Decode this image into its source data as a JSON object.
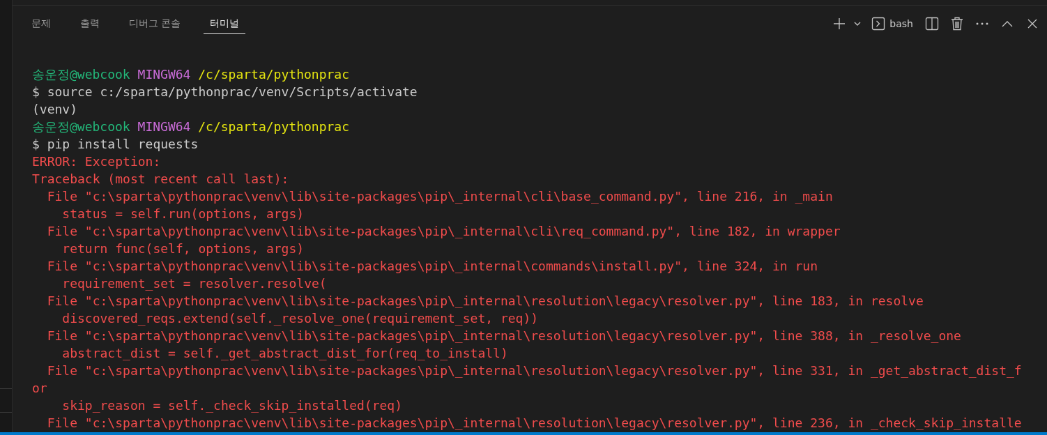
{
  "tabs": [
    {
      "label": "문제",
      "selected": false
    },
    {
      "label": "출력",
      "selected": false
    },
    {
      "label": "디버그 콘솔",
      "selected": false
    },
    {
      "label": "터미널",
      "selected": true
    }
  ],
  "toolbar": {
    "shell": "bash"
  },
  "terminal": {
    "lines": [
      {
        "kind": "prompt",
        "user": "송운정@webcook",
        "system": "MINGW64",
        "path": "/c/sparta/pythonprac"
      },
      {
        "kind": "command",
        "text": "$ source c:/sparta/pythonprac/venv/Scripts/activate"
      },
      {
        "kind": "command",
        "text": "(venv)"
      },
      {
        "kind": "prompt",
        "user": "송운정@webcook",
        "system": "MINGW64",
        "path": "/c/sparta/pythonprac"
      },
      {
        "kind": "command",
        "text": "$ pip install requests"
      },
      {
        "kind": "error",
        "text": "ERROR: Exception:"
      },
      {
        "kind": "error",
        "text": "Traceback (most recent call last):"
      },
      {
        "kind": "error",
        "text": "  File \"c:\\sparta\\pythonprac\\venv\\lib\\site-packages\\pip\\_internal\\cli\\base_command.py\", line 216, in _main"
      },
      {
        "kind": "error",
        "text": "    status = self.run(options, args)"
      },
      {
        "kind": "error",
        "text": "  File \"c:\\sparta\\pythonprac\\venv\\lib\\site-packages\\pip\\_internal\\cli\\req_command.py\", line 182, in wrapper"
      },
      {
        "kind": "error",
        "text": "    return func(self, options, args)"
      },
      {
        "kind": "error",
        "text": "  File \"c:\\sparta\\pythonprac\\venv\\lib\\site-packages\\pip\\_internal\\commands\\install.py\", line 324, in run"
      },
      {
        "kind": "error",
        "text": "    requirement_set = resolver.resolve("
      },
      {
        "kind": "error",
        "text": "  File \"c:\\sparta\\pythonprac\\venv\\lib\\site-packages\\pip\\_internal\\resolution\\legacy\\resolver.py\", line 183, in resolve"
      },
      {
        "kind": "error",
        "text": "    discovered_reqs.extend(self._resolve_one(requirement_set, req))"
      },
      {
        "kind": "error",
        "text": "  File \"c:\\sparta\\pythonprac\\venv\\lib\\site-packages\\pip\\_internal\\resolution\\legacy\\resolver.py\", line 388, in _resolve_one"
      },
      {
        "kind": "error",
        "text": "    abstract_dist = self._get_abstract_dist_for(req_to_install)"
      },
      {
        "kind": "error",
        "text": "  File \"c:\\sparta\\pythonprac\\venv\\lib\\site-packages\\pip\\_internal\\resolution\\legacy\\resolver.py\", line 331, in _get_abstract_dist_f"
      },
      {
        "kind": "error",
        "text": "or"
      },
      {
        "kind": "error",
        "text": "    skip_reason = self._check_skip_installed(req)"
      },
      {
        "kind": "error",
        "text": "  File \"c:\\sparta\\pythonprac\\venv\\lib\\site-packages\\pip\\_internal\\resolution\\legacy\\resolver.py\", line 236, in _check_skip_installe"
      }
    ]
  }
}
